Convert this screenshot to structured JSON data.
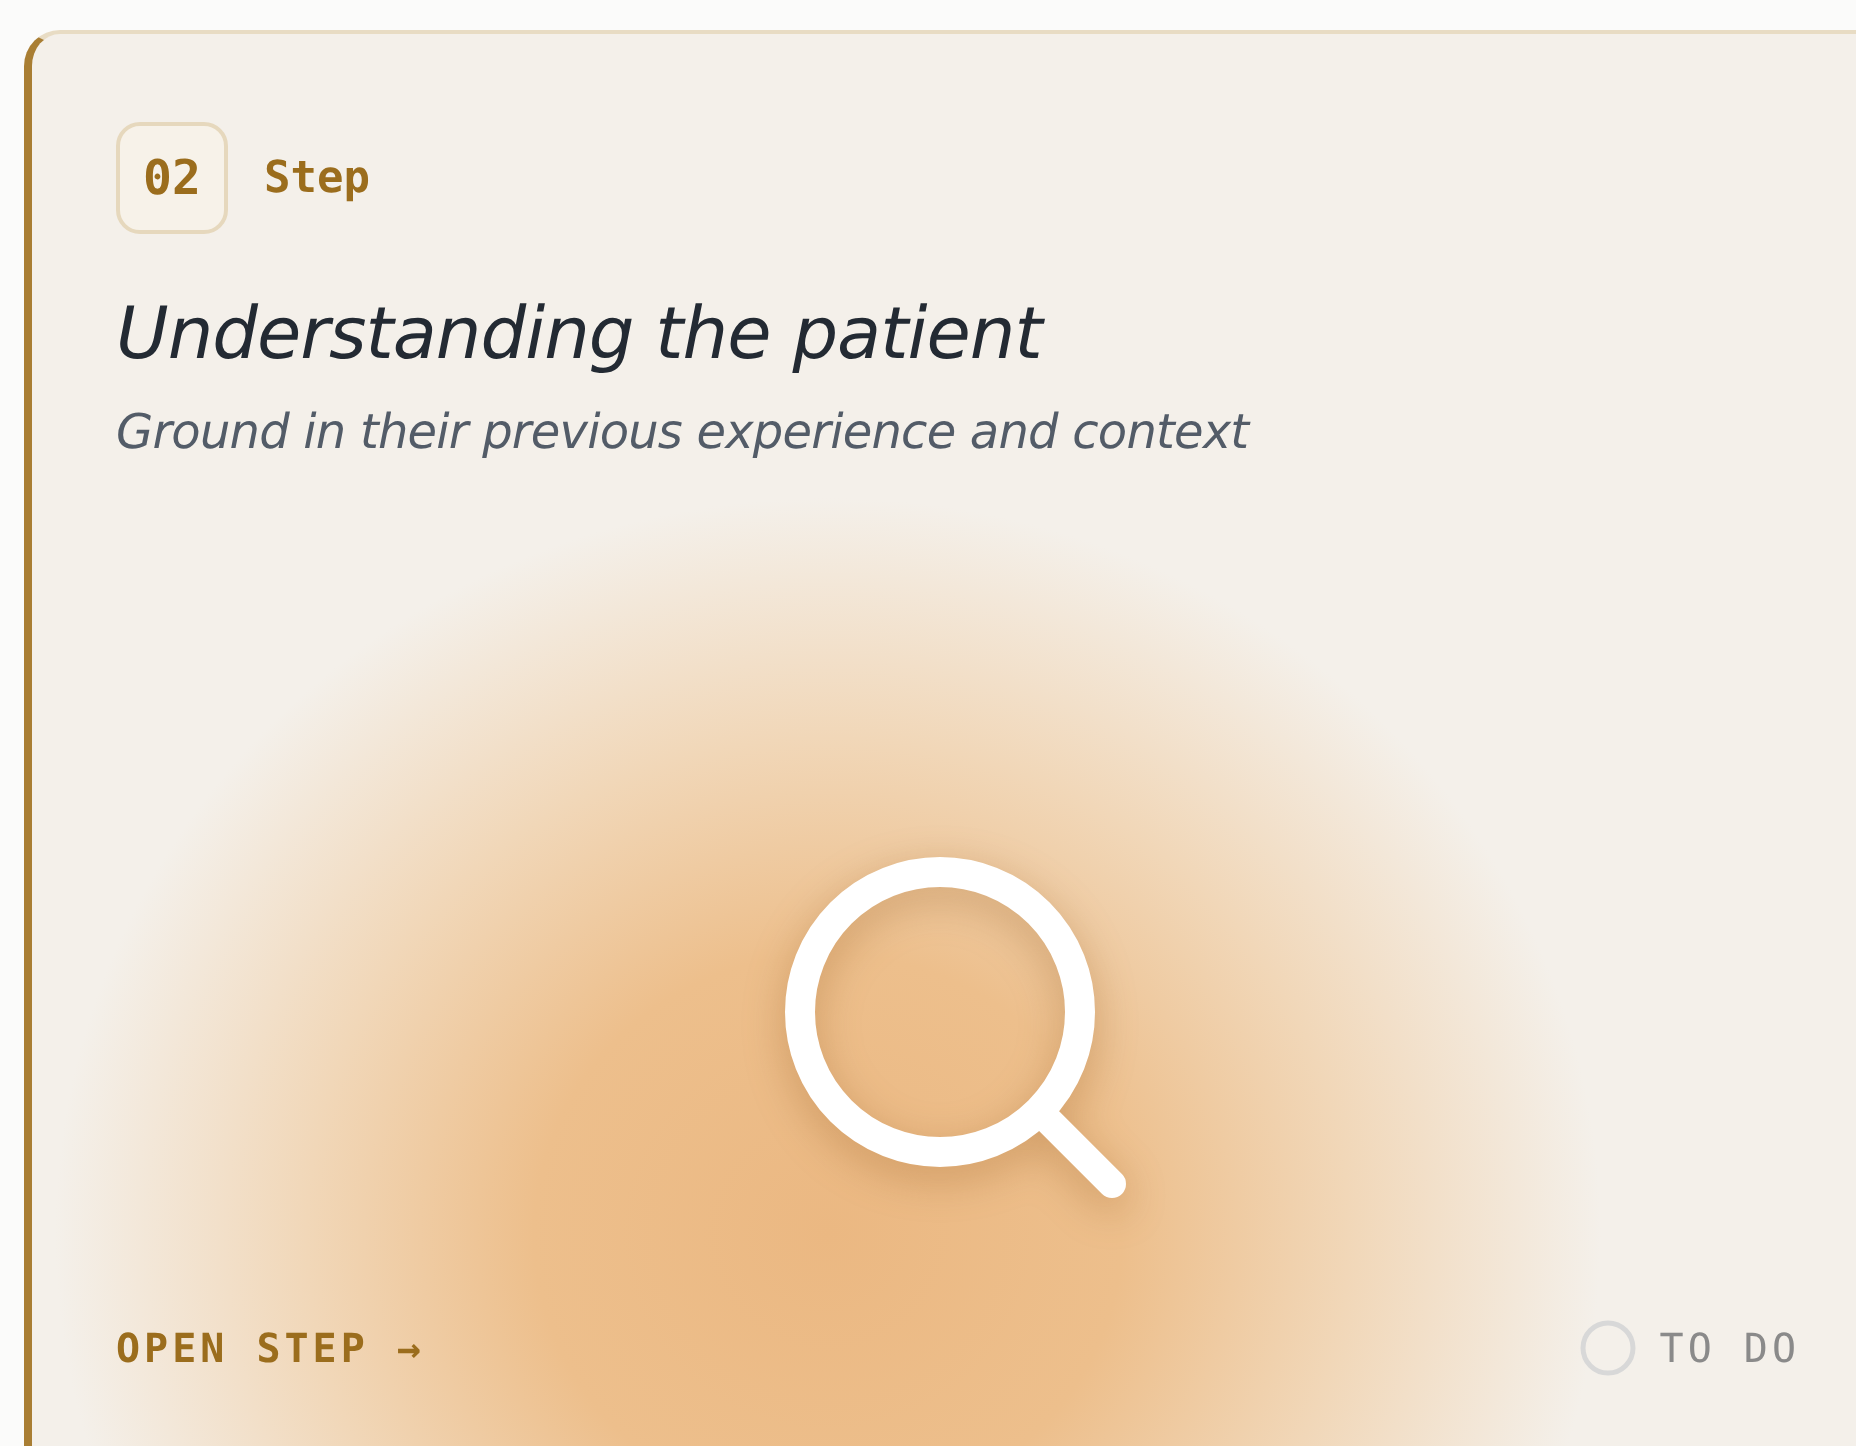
{
  "step": {
    "number": "02",
    "label": "Step",
    "title": "Understanding the patient",
    "subtitle": "Ground in their previous experience and context"
  },
  "action": {
    "label": "OPEN STEP",
    "arrow": "→"
  },
  "status": {
    "label": "TO DO",
    "done": false
  }
}
